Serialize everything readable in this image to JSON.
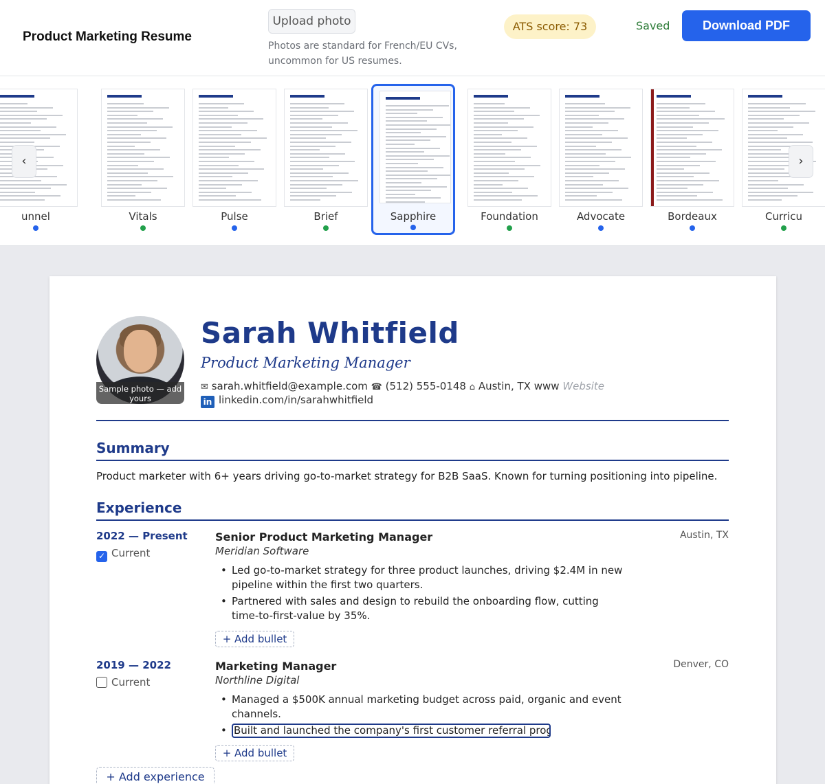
{
  "header": {
    "doc_title": "Product Marketing Resume",
    "upload_label": "Upload photo",
    "upload_hint": "Photos are standard for French/EU CVs, uncommon for US resumes.",
    "ats_label": "ATS score: 73",
    "saved_label": "Saved",
    "download_label": "Download PDF"
  },
  "carousel": {
    "prev_icon": "‹",
    "next_icon": "›",
    "templates": [
      {
        "name": "unnel",
        "dot_color": "#2563eb"
      },
      {
        "name": "Vitals",
        "dot_color": "#22a04b"
      },
      {
        "name": "Pulse",
        "dot_color": "#2563eb"
      },
      {
        "name": "Brief",
        "dot_color": "#22a04b"
      },
      {
        "name": "Sapphire",
        "dot_color": "#2563eb",
        "selected": true
      },
      {
        "name": "Foundation",
        "dot_color": "#22a04b"
      },
      {
        "name": "Advocate",
        "dot_color": "#2563eb"
      },
      {
        "name": "Bordeaux",
        "dot_color": "#2563eb"
      },
      {
        "name": "Curricu",
        "dot_color": "#22a04b"
      }
    ]
  },
  "resume": {
    "photo_caption": "Sample photo — add yours",
    "name": "Sarah Whitfield",
    "role": "Product Marketing Manager",
    "email": "sarah.whitfield@example.com",
    "phone": "(512) 555-0148",
    "location": "Austin, TX",
    "website_prefix": "www",
    "website_placeholder": "Website",
    "linkedin": "linkedin.com/in/sarahwhitfield",
    "summary_title": "Summary",
    "summary": "Product marketer with 6+ years driving go-to-market strategy for B2B SaaS. Known for turning positioning into pipeline.",
    "experience_title": "Experience",
    "current_label": "Current",
    "add_bullet_label": "+ Add bullet",
    "add_experience_label": "+ Add experience",
    "jobs": [
      {
        "dates": "2022 — Present",
        "current": true,
        "title": "Senior Product Marketing Manager",
        "company": "Meridian Software",
        "location": "Austin, TX",
        "bullets": [
          "Led go-to-market strategy for three product launches, driving $2.4M in new pipeline within the first two quarters.",
          "Partnered with sales and design to rebuild the onboarding flow, cutting time-to-first-value by 35%."
        ]
      },
      {
        "dates": "2019 — 2022",
        "current": false,
        "title": "Marketing Manager",
        "company": "Northline Digital",
        "location": "Denver, CO",
        "bullets": [
          "Managed a $500K annual marketing budget across paid, organic and event channels.",
          "Built and launched the company's first customer referral progr"
        ]
      }
    ]
  }
}
